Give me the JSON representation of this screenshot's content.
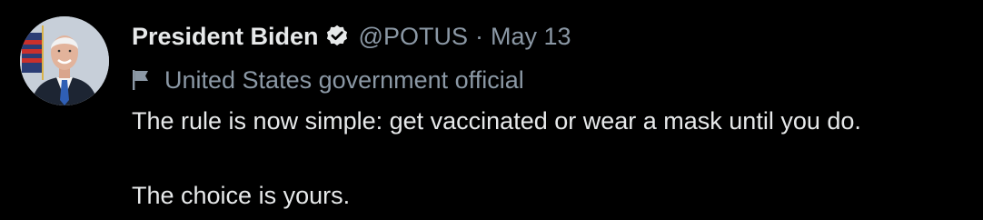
{
  "tweet": {
    "author": {
      "display_name": "President Biden",
      "handle": "@POTUS",
      "verified_icon": "verified-badge-icon",
      "avatar_icon": "avatar"
    },
    "separator": "·",
    "date": "May 13",
    "label": {
      "icon": "flag-icon",
      "text": "United States government official"
    },
    "text_lines": [
      "The rule is now simple: get vaccinated or wear a mask until you do.",
      "The choice is yours."
    ]
  },
  "colors": {
    "background": "#000000",
    "primary_text": "#e7e9ea",
    "secondary_text": "#8b98a5"
  }
}
